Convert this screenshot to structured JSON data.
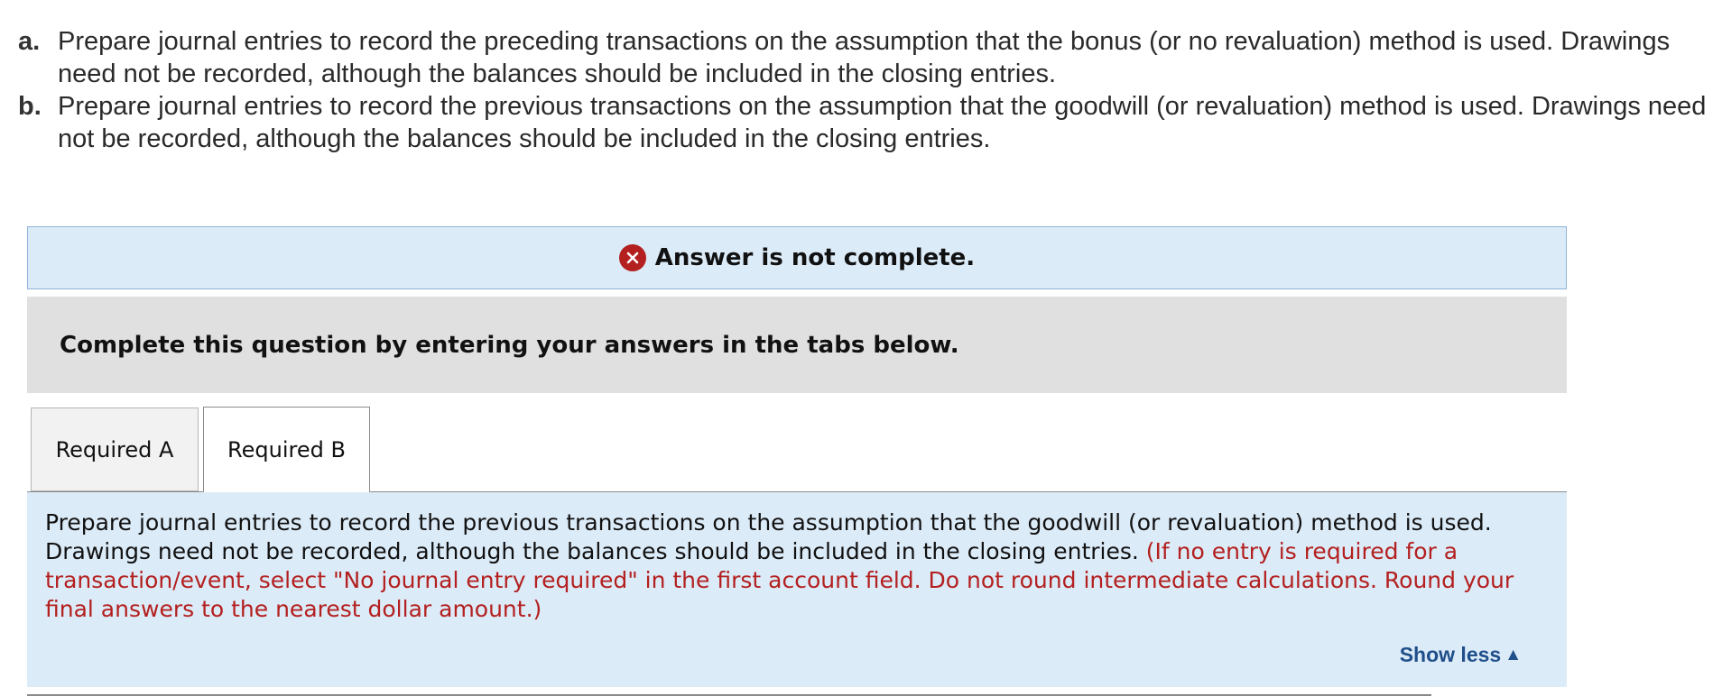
{
  "questions": [
    {
      "letter": "a.",
      "text": "Prepare journal entries to record the preceding transactions on the assumption that the bonus (or no revaluation) method is used. Drawings need not be recorded, although the balances should be included in the closing entries."
    },
    {
      "letter": "b.",
      "text": "Prepare journal entries to record the previous transactions on the assumption that the goodwill (or revaluation) method is used. Drawings need not be recorded, although the balances should be included in the closing entries."
    }
  ],
  "status": {
    "icon": "x-circle-icon",
    "text": "Answer is not complete.",
    "icon_color": "#b3201f"
  },
  "instruction": "Complete this question by entering your answers in the tabs below.",
  "tabs": [
    {
      "label": "Required A",
      "active": false
    },
    {
      "label": "Required B",
      "active": true
    }
  ],
  "panel": {
    "text": "Prepare journal entries to record the previous transactions on the assumption that the goodwill (or revaluation) method is used. Drawings need not be recorded, although the balances should be included in the closing entries.",
    "note": "(If no entry is required for a transaction/event, select \"No journal entry required\" in the first account field. Do not round intermediate calculations. Round your final answers to the nearest dollar amount.)",
    "show_less_label": "Show less",
    "show_less_icon": "triangle-up-icon"
  },
  "colors": {
    "banner_bg": "#dcebf8",
    "instruction_bg": "#e0e0e0",
    "note_red": "#b3201f",
    "link_blue": "#1f4e8a"
  }
}
